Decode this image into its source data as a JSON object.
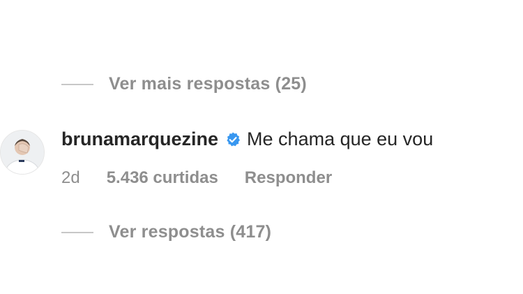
{
  "thread": {
    "more_replies_label": "Ver mais respostas (25)",
    "view_replies_label": "Ver respostas (417)"
  },
  "comment": {
    "username": "brunamarquezine",
    "verified_icon": "verified-badge-icon",
    "text": "Me chama que eu vou",
    "time": "2d",
    "likes": "5.436 curtidas",
    "reply_label": "Responder"
  },
  "colors": {
    "primary_text": "#262626",
    "secondary_text": "#8e8e8e",
    "divider": "#c7c7c7",
    "verified_blue": "#3897f0"
  }
}
